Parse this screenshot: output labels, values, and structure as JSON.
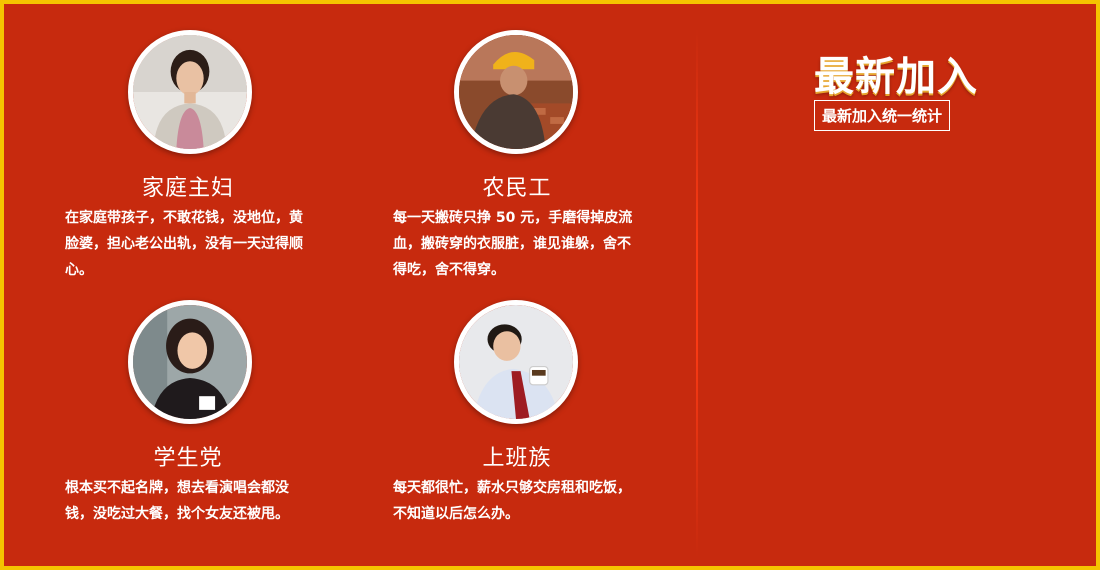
{
  "cards": [
    {
      "title": "家庭主妇",
      "description": "在家庭带孩子，不敢花钱，没地位，黄脸婆，担心老公出轨，没有一天过得顺心。",
      "avatar_icon": "housewife-photo"
    },
    {
      "title": "农民工",
      "description": "每一天搬砖只挣 50 元，手磨得掉皮流血，搬砖穿的衣服脏，谁见谁躲，舍不得吃，舍不得穿。",
      "avatar_icon": "worker-photo"
    },
    {
      "title": "学生党",
      "description": "根本买不起名牌，想去看演唱会都没钱，没吃过大餐，找个女友还被甩。",
      "avatar_icon": "student-photo"
    },
    {
      "title": "上班族",
      "description": "每天都很忙，薪水只够交房租和吃饭，不知道以后怎么办。",
      "avatar_icon": "office-worker-photo"
    }
  ],
  "side": {
    "title": "最新加入",
    "badge": "最新加入统一统计"
  },
  "colors": {
    "background": "#c72a0e",
    "border": "#f5c400",
    "text": "#ffffff"
  }
}
